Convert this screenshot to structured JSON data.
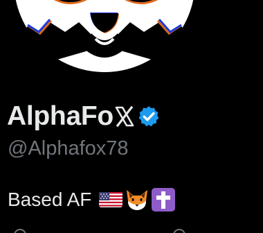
{
  "profile": {
    "display_name": "AlphaFo",
    "handle": "@Alphafox78",
    "bio_text": "Based AF",
    "bio_emojis": [
      "us-flag-emoji",
      "fox-emoji",
      "latin-cross-emoji"
    ]
  },
  "icons": {
    "x_logo": "x-logo-icon",
    "verified": "verified-badge-icon"
  },
  "colors": {
    "background": "#000000",
    "text_primary": "#e7e9ea",
    "text_secondary": "#71767b",
    "verified": "#1d9bf0",
    "cross_bg": "#8e5cc9"
  }
}
